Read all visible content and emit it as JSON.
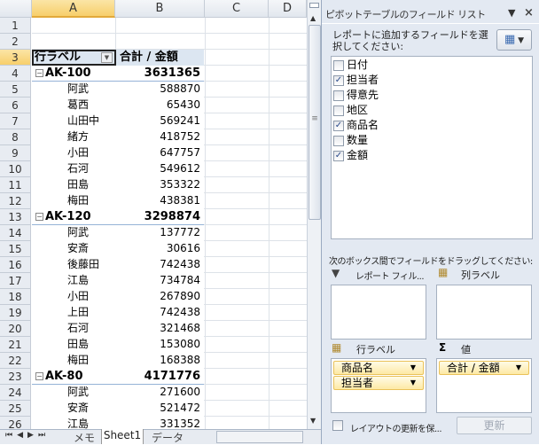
{
  "columns": [
    "A",
    "B",
    "C",
    "D"
  ],
  "rows": [
    "1",
    "2",
    "3",
    "4",
    "5",
    "6",
    "7",
    "8",
    "9",
    "10",
    "11",
    "12",
    "13",
    "14",
    "15",
    "16",
    "17",
    "18",
    "19",
    "20",
    "21",
    "22",
    "23",
    "24",
    "25",
    "26"
  ],
  "pivot": {
    "row_label_header": "行ラベル",
    "value_header": "合計 / 金額",
    "lines": [
      {
        "type": "group",
        "label": "AK-100",
        "value": "3631365"
      },
      {
        "type": "child",
        "label": "阿武",
        "value": "588870"
      },
      {
        "type": "child",
        "label": "葛西",
        "value": "65430"
      },
      {
        "type": "child",
        "label": "山田中",
        "value": "569241"
      },
      {
        "type": "child",
        "label": "緒方",
        "value": "418752"
      },
      {
        "type": "child",
        "label": "小田",
        "value": "647757"
      },
      {
        "type": "child",
        "label": "石河",
        "value": "549612"
      },
      {
        "type": "child",
        "label": "田島",
        "value": "353322"
      },
      {
        "type": "child",
        "label": "梅田",
        "value": "438381"
      },
      {
        "type": "group",
        "label": "AK-120",
        "value": "3298874"
      },
      {
        "type": "child",
        "label": "阿武",
        "value": "137772"
      },
      {
        "type": "child",
        "label": "安斎",
        "value": "30616"
      },
      {
        "type": "child",
        "label": "後藤田",
        "value": "742438"
      },
      {
        "type": "child",
        "label": "江島",
        "value": "734784"
      },
      {
        "type": "child",
        "label": "小田",
        "value": "267890"
      },
      {
        "type": "child",
        "label": "上田",
        "value": "742438"
      },
      {
        "type": "child",
        "label": "石河",
        "value": "321468"
      },
      {
        "type": "child",
        "label": "田島",
        "value": "153080"
      },
      {
        "type": "child",
        "label": "梅田",
        "value": "168388"
      },
      {
        "type": "group",
        "label": "AK-80",
        "value": "4171776"
      },
      {
        "type": "child",
        "label": "阿武",
        "value": "271600"
      },
      {
        "type": "child",
        "label": "安斎",
        "value": "521472"
      },
      {
        "type": "child",
        "label": "江島",
        "value": "331352"
      }
    ]
  },
  "sheet_tabs": {
    "items": [
      "メモ",
      "Sheet1",
      "データ"
    ],
    "active": "Sheet1"
  },
  "pane": {
    "title": "ピボットテーブルのフィールド リスト",
    "choose_label": "レポートに追加するフィールドを選択してください:",
    "fields": [
      {
        "label": "日付",
        "checked": false
      },
      {
        "label": "担当者",
        "checked": true
      },
      {
        "label": "得意先",
        "checked": false
      },
      {
        "label": "地区",
        "checked": false
      },
      {
        "label": "商品名",
        "checked": true
      },
      {
        "label": "数量",
        "checked": false
      },
      {
        "label": "金額",
        "checked": true
      }
    ],
    "drag_label": "次のボックス間でフィールドをドラッグしてください:",
    "report_filter": "レポート フィル...",
    "column_labels": "列ラベル",
    "row_labels": "行ラベル",
    "values": "値",
    "row_fields": [
      "商品名",
      "担当者"
    ],
    "value_fields": [
      "合計 / 金額"
    ],
    "defer_label": "レイアウトの更新を保...",
    "update_button": "更新"
  },
  "colors": {
    "selected_header": "#f7cf6b",
    "pane_bg": "#e3e9f2",
    "chip": "#fde9a5",
    "pivot_header": "#dce6f1"
  }
}
